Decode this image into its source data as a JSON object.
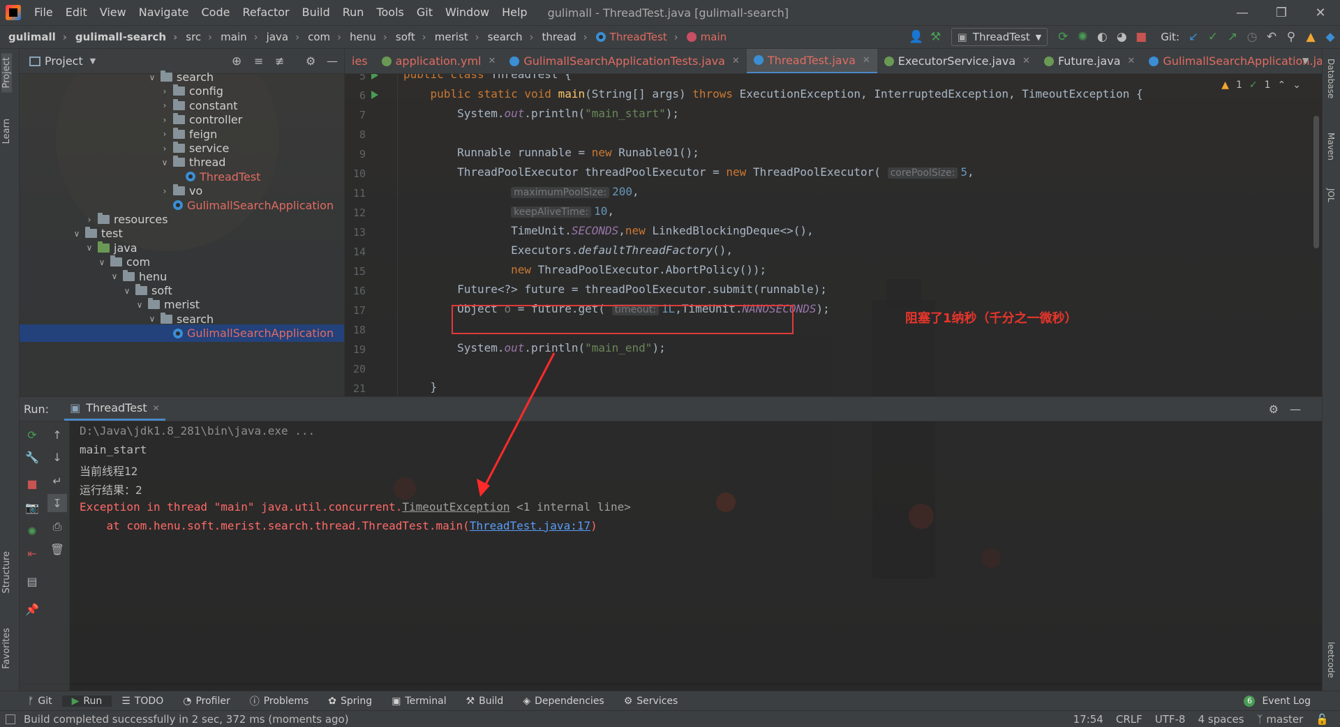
{
  "menubar": {
    "items": [
      "File",
      "Edit",
      "View",
      "Navigate",
      "Code",
      "Refactor",
      "Build",
      "Run",
      "Tools",
      "Git",
      "Window",
      "Help"
    ],
    "window_title": "gulimall - ThreadTest.java [gulimall-search]"
  },
  "navbar": {
    "breadcrumbs": [
      "gulimall",
      "gulimall-search",
      "src",
      "main",
      "java",
      "com",
      "henu",
      "soft",
      "merist",
      "search",
      "thread",
      "ThreadTest",
      "main"
    ],
    "run_config": "ThreadTest",
    "git_label": "Git:"
  },
  "project": {
    "title": "Project",
    "tree": [
      {
        "label": "search",
        "indent": 9,
        "expanded": true,
        "type": "folder"
      },
      {
        "label": "config",
        "indent": 10,
        "expanded": false,
        "type": "folder"
      },
      {
        "label": "constant",
        "indent": 10,
        "expanded": false,
        "type": "folder"
      },
      {
        "label": "controller",
        "indent": 10,
        "expanded": false,
        "type": "folder"
      },
      {
        "label": "feign",
        "indent": 10,
        "expanded": false,
        "type": "folder"
      },
      {
        "label": "service",
        "indent": 10,
        "expanded": false,
        "type": "folder"
      },
      {
        "label": "thread",
        "indent": 10,
        "expanded": true,
        "type": "folder"
      },
      {
        "label": "ThreadTest",
        "indent": 11,
        "type": "class",
        "red": true
      },
      {
        "label": "vo",
        "indent": 10,
        "expanded": false,
        "type": "folder"
      },
      {
        "label": "GulimallSearchApplication",
        "indent": 10,
        "type": "class",
        "red": true
      },
      {
        "label": "resources",
        "indent": 4,
        "expanded": false,
        "type": "folder"
      },
      {
        "label": "test",
        "indent": 3,
        "expanded": true,
        "type": "folder"
      },
      {
        "label": "java",
        "indent": 4,
        "expanded": true,
        "type": "folder-green"
      },
      {
        "label": "com",
        "indent": 5,
        "expanded": true,
        "type": "folder"
      },
      {
        "label": "henu",
        "indent": 6,
        "expanded": true,
        "type": "folder"
      },
      {
        "label": "soft",
        "indent": 7,
        "expanded": true,
        "type": "folder"
      },
      {
        "label": "merist",
        "indent": 8,
        "expanded": true,
        "type": "folder"
      },
      {
        "label": "search",
        "indent": 9,
        "expanded": true,
        "type": "folder"
      },
      {
        "label": "GulimallSearchApplication",
        "indent": 10,
        "type": "class",
        "red": true,
        "selected": true
      }
    ]
  },
  "tabs": [
    {
      "label": "ies",
      "icon": "none",
      "red": true
    },
    {
      "label": "application.yml",
      "icon": "ic-g",
      "red": true
    },
    {
      "label": "GulimallSearchApplicationTests.java",
      "icon": "ic-c",
      "red": true
    },
    {
      "label": "ThreadTest.java",
      "icon": "ic-c",
      "red": true,
      "active": true
    },
    {
      "label": "ExecutorService.java",
      "icon": "ic-i",
      "red": false
    },
    {
      "label": "Future.java",
      "icon": "ic-i",
      "red": false
    },
    {
      "label": "GulimallSearchApplication.java",
      "icon": "ic-c",
      "red": true
    }
  ],
  "editor": {
    "line_numbers": [
      "5",
      "6",
      "7",
      "8",
      "9",
      "10",
      "11",
      "12",
      "13",
      "14",
      "15",
      "16",
      "17",
      "18",
      "19",
      "20",
      "21"
    ],
    "inspections": {
      "warnings": "1",
      "ok": "1"
    },
    "annotation": "阻塞了1纳秒（千分之一微秒）",
    "hints": {
      "corePoolSize": "corePoolSize:",
      "maximumPoolSize": "maximumPoolSize:",
      "keepAliveTime": "keepAliveTime:",
      "timeout": "timeout:"
    }
  },
  "run": {
    "label": "Run:",
    "tab": "ThreadTest",
    "console": {
      "cmd": "D:\\Java\\jdk1.8_281\\bin\\java.exe ...",
      "line1": "main_start",
      "line2": "当前线程12",
      "line3": "运行结果：2",
      "exc_prefix": "Exception in thread \"main\" java.util.concurrent.",
      "exc_class": "TimeoutException",
      "exc_internal": " <1 internal line>",
      "at_prefix": "    at com.henu.soft.merist.search.thread.ThreadTest.main(",
      "at_link": "ThreadTest.java:17",
      "at_suffix": ")"
    }
  },
  "toolwindows": [
    "Git",
    "Run",
    "TODO",
    "Profiler",
    "Problems",
    "Spring",
    "Terminal",
    "Build",
    "Dependencies",
    "Services"
  ],
  "event_log": {
    "count": "6",
    "label": "Event Log"
  },
  "status": {
    "message": "Build completed successfully in 2 sec, 372 ms (moments ago)",
    "position": "17:54",
    "line_sep": "CRLF",
    "encoding": "UTF-8",
    "indent": "4 spaces",
    "branch": "master"
  },
  "side_labels": {
    "left": [
      "Project",
      "Learn",
      "Structure",
      "Favorites"
    ],
    "right": [
      "Database",
      "Maven",
      "JOL",
      "leetcode"
    ]
  }
}
